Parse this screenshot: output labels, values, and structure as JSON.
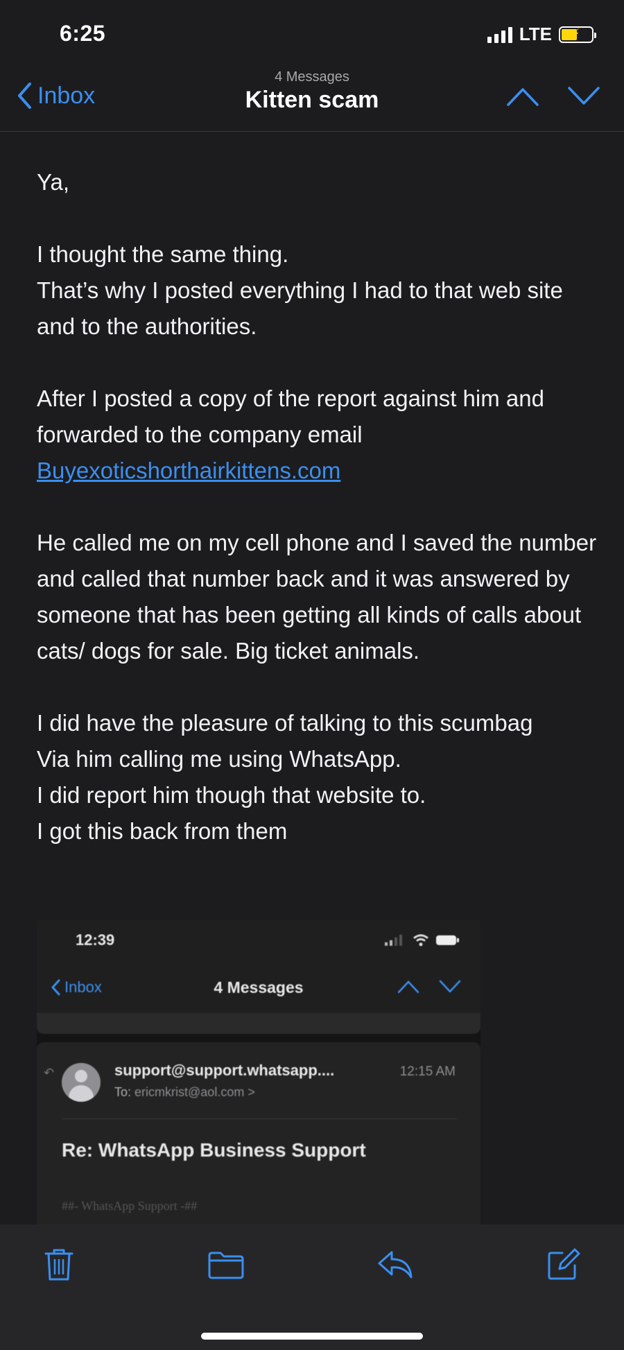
{
  "status_bar": {
    "time": "6:25",
    "network": "LTE",
    "battery_color": "#ffd60a"
  },
  "nav": {
    "back_label": "Inbox",
    "subtitle": "4 Messages",
    "title": "Kitten scam",
    "accent_color": "#3b8ff0"
  },
  "message": {
    "greeting": "Ya,",
    "para1": [
      "I thought the same thing.",
      "That’s why I posted everything I had to that web site and to the authorities."
    ],
    "para2_text": "After I posted a copy of the report against him and forwarded to the company email",
    "para2_link": "Buyexoticshorthairkittens.com",
    "para3": "He called me on my cell phone and I saved the number and called that number back and it was answered by someone that has been getting all kinds of calls about cats/ dogs for sale. Big ticket animals.",
    "para4": [
      "I did have the pleasure of talking to this scumbag",
      "Via him calling me using WhatsApp.",
      "I did report him though that website to.",
      "I got this back from them"
    ]
  },
  "embedded_screenshot": {
    "time": "12:39",
    "back_label": "Inbox",
    "title": "4 Messages",
    "from": "support@support.whatsapp....",
    "timestamp": "12:15 AM",
    "to_label": "To:",
    "to_address": "ericmkrist@aol.com >",
    "subject": "Re: WhatsApp Business Support",
    "footer": "##- WhatsApp Support -##"
  },
  "toolbar": {
    "icons": [
      "trash-icon",
      "folder-icon",
      "reply-icon",
      "compose-icon"
    ]
  }
}
